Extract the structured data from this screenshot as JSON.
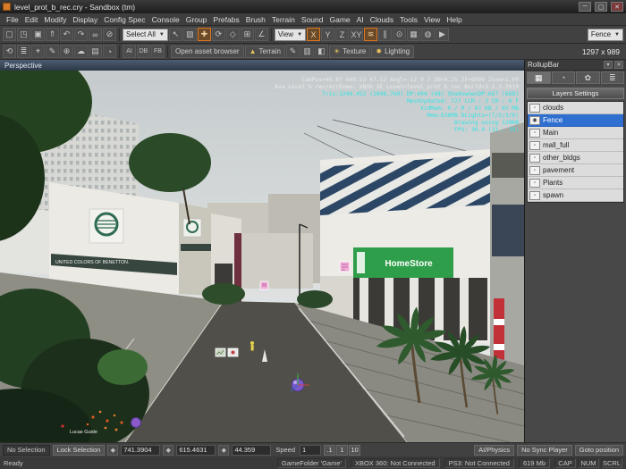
{
  "window": {
    "title": "level_prot_b_rec.cry - Sandbox (tm)",
    "controls": {
      "minimize": "─",
      "maximize": "▢",
      "close": "✕"
    }
  },
  "menu": {
    "items": [
      "File",
      "Edit",
      "Modify",
      "Display",
      "Config Spec",
      "Console",
      "Group",
      "Prefabs",
      "Brush",
      "Terrain",
      "Sound",
      "Game",
      "AI",
      "Clouds",
      "Tools",
      "View",
      "Help"
    ]
  },
  "toolbar1": {
    "groupA": [
      {
        "dn": "new-file-icon",
        "g": "▢"
      },
      {
        "dn": "open-file-icon",
        "g": "◳"
      },
      {
        "dn": "save-icon",
        "g": "▣"
      },
      {
        "dn": "export-level-icon",
        "g": "⇑"
      },
      {
        "dn": "undo-icon",
        "g": "↶"
      },
      {
        "dn": "redo-icon",
        "g": "↷"
      },
      {
        "dn": "link-icon",
        "g": "∞"
      },
      {
        "dn": "unlink-icon",
        "g": "⊘"
      }
    ],
    "select_all_label": "Select All",
    "groupB": [
      {
        "dn": "select-pointer-icon",
        "g": "↖"
      },
      {
        "dn": "select-area-icon",
        "g": "▧"
      },
      {
        "dn": "move-tool-icon",
        "g": "✚",
        "cls": "active"
      },
      {
        "dn": "rotate-tool-icon",
        "g": "⟳"
      },
      {
        "dn": "scale-tool-icon",
        "g": "◇"
      },
      {
        "dn": "snap-grid-icon",
        "g": "⊞"
      },
      {
        "dn": "snap-angle-icon",
        "g": "∠"
      }
    ],
    "view_label": "View",
    "groupC": [
      {
        "dn": "axis-x-button",
        "g": "X",
        "cls": "active"
      },
      {
        "dn": "axis-y-button",
        "g": "Y"
      },
      {
        "dn": "axis-z-button",
        "g": "Z"
      },
      {
        "dn": "axis-xy-button",
        "g": "XY"
      },
      {
        "dn": "follow-terrain-icon",
        "g": "≋",
        "cls": "active"
      },
      {
        "dn": "ruler-icon",
        "g": "∥"
      },
      {
        "dn": "selection-lock-icon",
        "g": "⊙"
      },
      {
        "dn": "camera-icon",
        "g": "▦"
      },
      {
        "dn": "physics-sim-icon",
        "g": "◍"
      },
      {
        "dn": "play-game-icon",
        "g": "▶"
      }
    ],
    "fence_label": "Fence"
  },
  "toolbar2": {
    "groupA": [
      {
        "dn": "reload-script-icon",
        "g": "⟲"
      },
      {
        "dn": "layer-list-icon",
        "g": "≣"
      },
      {
        "dn": "goto-selection-icon",
        "g": "⌖"
      },
      {
        "dn": "pick-material-icon",
        "g": "✎"
      },
      {
        "dn": "add-object-icon",
        "g": "⊕"
      },
      {
        "dn": "clouds-icon",
        "g": "☁"
      },
      {
        "dn": "vegetation-icon",
        "g": "▤"
      },
      {
        "dn": "time-of-day-icon",
        "g": "◔"
      }
    ],
    "ai_label": "AI",
    "db_label": "DB",
    "fb_label": "FB",
    "asset_browser_label": "Open asset browser",
    "terrain_label": "Terrain",
    "groupB": [
      {
        "dn": "terrain-paint-icon",
        "g": "✎"
      },
      {
        "dn": "terrain-layers-icon",
        "g": "▥"
      },
      {
        "dn": "mask-icon",
        "g": "◧"
      }
    ],
    "texture_label": "Texture",
    "lighting_label": "Lighting",
    "sun_icon": "☀",
    "bulb_icon": "✹",
    "resolution": "1297 x 989"
  },
  "viewport": {
    "label": "Perspective",
    "debug": [
      "CamPos=49.07 649.53 47.52 Angl=-12 0 7 ZN=0.25 ZF=8000 Zoom=1.00",
      "Ava_Level_b_rec/AirDome: XBOX SE Level=level_prot_b_rec Build=3.2.3.2019",
      "Tris:2240,452 (2048,760) DP:494 (48) ShadowGenDP:667 (668)",
      "MeshUpdated: 727 LCM : 3 CM : 0 F",
      "VidMem: 0 / 0 / 87 KB / 45 MB",
      "Mem:636MB DLights=(7/2/2/6)",
      "Drawing using 120KB",
      "FPS: 30.4 (31.. 39)"
    ],
    "scene": {
      "benetton": "UNITED COLORS OF BENETTON.",
      "homestore": "HomeStore",
      "entity_label": "Lucas Guide"
    }
  },
  "rollupbar": {
    "title": "RollupBar",
    "controls": [
      "▾",
      "✕"
    ],
    "tabs": [
      {
        "dn": "rollup-tab-objects",
        "g": "▦",
        "cls": "active"
      },
      {
        "dn": "rollup-tab-terrain",
        "g": "◔"
      },
      {
        "dn": "rollup-tab-modelling",
        "g": "✿"
      },
      {
        "dn": "rollup-tab-layers",
        "g": "≣"
      }
    ],
    "section": "Layers Settings",
    "layers": [
      {
        "name": "clouds",
        "icon": "▫"
      },
      {
        "name": "Fence",
        "icon": "◉",
        "cls": "selected"
      },
      {
        "name": "Main",
        "icon": "▫"
      },
      {
        "name": "mall_full",
        "icon": "▫"
      },
      {
        "name": "other_bldgs",
        "icon": "▫"
      },
      {
        "name": "pavement",
        "icon": "▫"
      },
      {
        "name": "Plants",
        "icon": "▫"
      },
      {
        "name": "spawn",
        "icon": "▫"
      }
    ]
  },
  "bottombar": {
    "selection": "No Selection",
    "lock_label": "Lock Selection",
    "x_icon": "◆",
    "y_icon": "◆",
    "z_icon": "◆",
    "x": "741.3904",
    "y": "615.4631",
    "z": "44.359",
    "speed_label": "Speed",
    "speed": "1",
    "presets": [
      ".1",
      "1",
      "10"
    ],
    "ai_physics_label": "AI/Physics",
    "no_sync_label": "No Sync Player",
    "goto_label": "Goto position"
  },
  "statusbar": {
    "ready": "Ready",
    "gamefolder": "GameFolder 'Game'",
    "xbox": "XBOX 360: Not Connected",
    "ps3": "PS3: Not Connected",
    "memory": "619 Mb",
    "flags": [
      "CAP",
      "NUM",
      "SCRL"
    ]
  },
  "colors": {
    "accent_orange": "#d97b2a",
    "selection_blue": "#2f6fd0",
    "debug_cyan": "#35e3e3",
    "sign_green": "#2f9e4a"
  }
}
